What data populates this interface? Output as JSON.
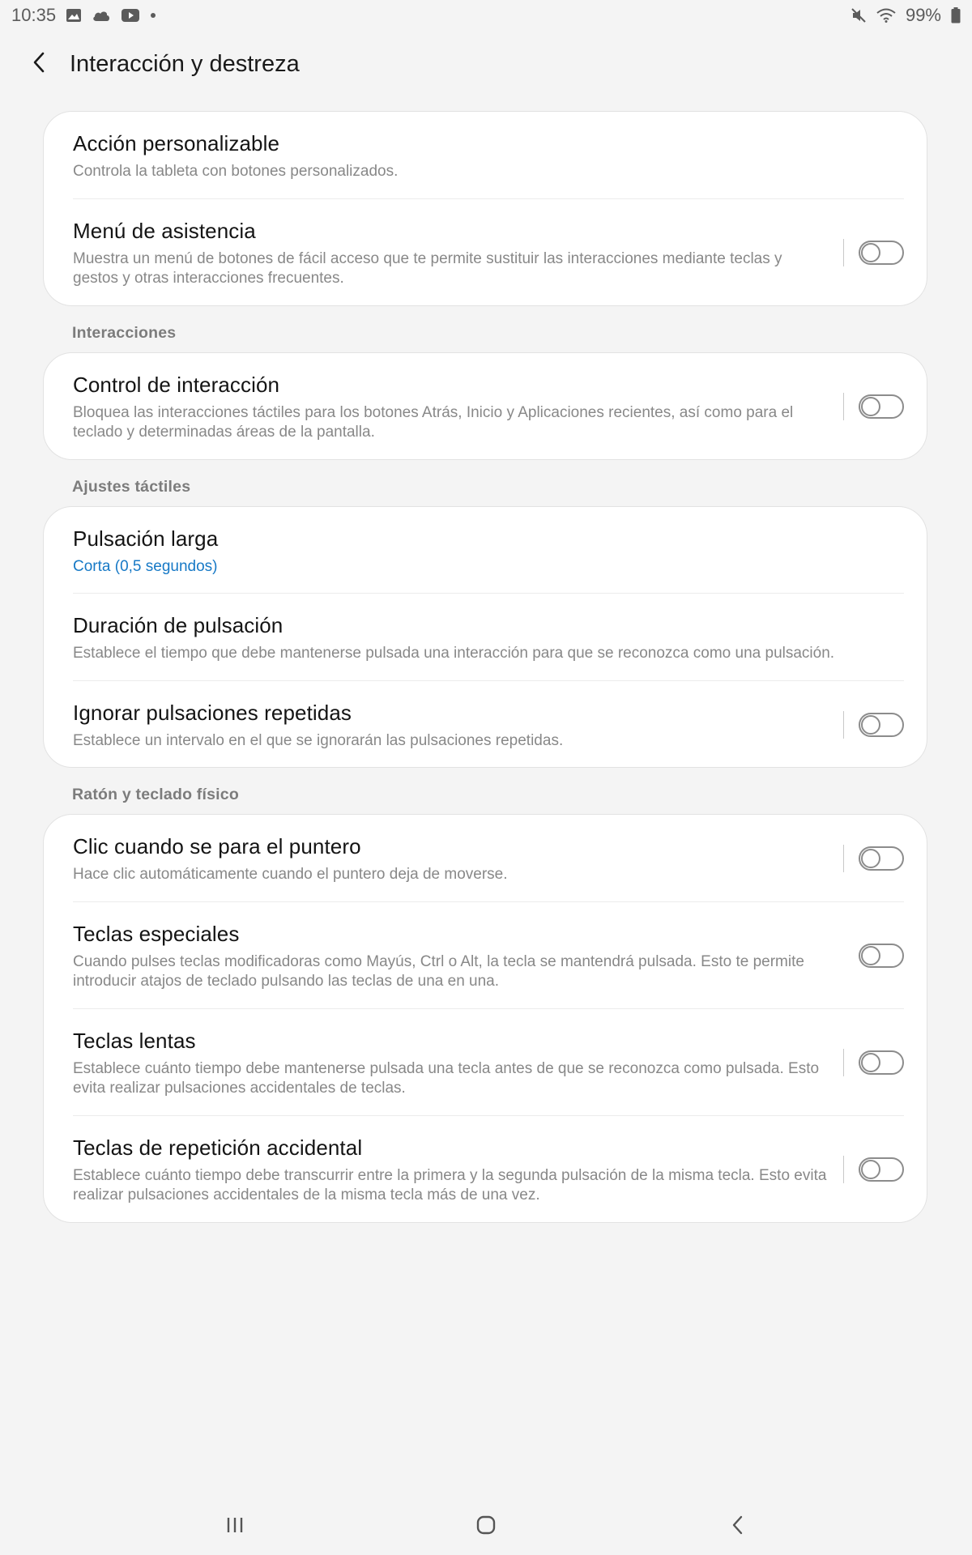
{
  "status_bar": {
    "time": "10:35",
    "battery": "99%",
    "icons_left": [
      "image-icon",
      "cloud-icon",
      "youtube-icon",
      "dot-icon"
    ],
    "icons_right": [
      "mute-icon",
      "wifi-icon",
      "battery-icon"
    ]
  },
  "header": {
    "title": "Interacción y destreza"
  },
  "cards": [
    {
      "section": "",
      "items": [
        {
          "title": "Acción personalizable",
          "subtitle": "Controla la tableta con botones personalizados.",
          "toggle": false
        },
        {
          "title": "Menú de asistencia",
          "subtitle": "Muestra un menú de botones de fácil acceso que te permite sustituir las interacciones mediante teclas y gestos y otras interacciones frecuentes.",
          "toggle": true,
          "on": false
        }
      ]
    },
    {
      "section": "Interacciones",
      "items": [
        {
          "title": "Control de interacción",
          "subtitle": "Bloquea las interacciones táctiles para los botones Atrás, Inicio y Aplicaciones recientes, así como para el teclado y determinadas áreas de la pantalla.",
          "toggle": true,
          "on": false
        }
      ]
    },
    {
      "section": "Ajustes táctiles",
      "items": [
        {
          "title": "Pulsación larga",
          "subtitle": "Corta (0,5 segundos)",
          "accent": true
        },
        {
          "title": "Duración de pulsación",
          "subtitle": "Establece el tiempo que debe mantenerse pulsada una interacción para que se reconozca como una pulsación."
        },
        {
          "title": "Ignorar pulsaciones repetidas",
          "subtitle": "Establece un intervalo en el que se ignorarán las pulsaciones repetidas.",
          "toggle": true,
          "on": false
        }
      ]
    },
    {
      "section": "Ratón y teclado físico",
      "items": [
        {
          "title": "Clic cuando se para el puntero",
          "subtitle": "Hace clic automáticamente cuando el puntero deja de moverse.",
          "toggle": true,
          "on": false
        },
        {
          "title": "Teclas especiales",
          "subtitle": "Cuando pulses teclas modificadoras como Mayús, Ctrl o Alt, la tecla se mantendrá pulsada. Esto te permite introducir atajos de teclado pulsando las teclas de una en una.",
          "toggle": true,
          "on": false,
          "no_divider": true
        },
        {
          "title": "Teclas lentas",
          "subtitle": "Establece cuánto tiempo debe mantenerse pulsada una tecla antes de que se reconozca como pulsada. Esto evita realizar pulsaciones accidentales de teclas.",
          "toggle": true,
          "on": false
        },
        {
          "title": "Teclas de repetición accidental",
          "subtitle": "Establece cuánto tiempo debe transcurrir entre la primera y la segunda pulsación de la misma tecla. Esto evita realizar pulsaciones accidentales de la misma tecla más de una vez.",
          "toggle": true,
          "on": false
        }
      ]
    }
  ],
  "nav_bar": {
    "icons": [
      "recents-icon",
      "home-icon",
      "back-nav-icon"
    ]
  },
  "colors": {
    "background": "#f4f4f4",
    "card": "#ffffff",
    "accent": "#1779c6",
    "subtitle": "#888888"
  }
}
